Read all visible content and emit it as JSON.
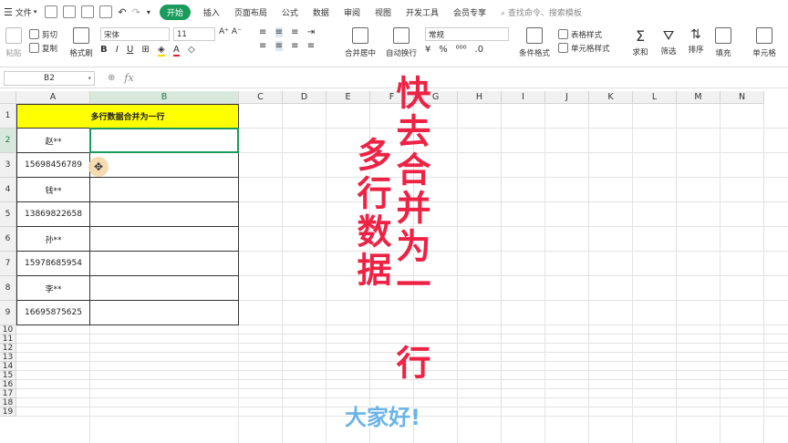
{
  "toolbar": {
    "menu_label": "文件",
    "tabs": [
      "开始",
      "插入",
      "页面布局",
      "公式",
      "数据",
      "审阅",
      "视图",
      "开发工具",
      "会员专享"
    ],
    "search_placeholder": "查找命令、搜索模板"
  },
  "ribbon": {
    "paste": "粘贴",
    "cut": "剪切",
    "copy": "复制",
    "format_painter": "格式刷",
    "font_name": "宋体",
    "font_size": "11",
    "bold": "B",
    "italic": "I",
    "underline": "U",
    "merge_center": "合并居中",
    "wrap_text": "自动换行",
    "number_format": "常规",
    "percent": "%",
    "table_style": "表格样式",
    "cond_format": "条件格式",
    "cell_style": "单元格样式",
    "sum": "求和",
    "filter": "筛选",
    "sort": "排序",
    "fill": "填充",
    "cells": "单元格"
  },
  "formula_bar": {
    "name_box": "B2",
    "fx": "fx",
    "value": ""
  },
  "columns": [
    "A",
    "B",
    "C",
    "D",
    "E",
    "F",
    "G",
    "H",
    "I",
    "J",
    "K",
    "L",
    "M",
    "N"
  ],
  "rows": [
    "1",
    "2",
    "3",
    "4",
    "5",
    "6",
    "7",
    "8",
    "9",
    "10",
    "11",
    "12",
    "13",
    "14",
    "15",
    "16",
    "17",
    "18",
    "19"
  ],
  "table": {
    "title": "多行数据合并为一行",
    "a_values": [
      "赵**",
      "15698456789",
      "钱**",
      "13869822658",
      "孙**",
      "15978685954",
      "李**",
      "16695875625"
    ]
  },
  "overlay": {
    "left_text": "多行数据",
    "right_text": "快去合并为一行",
    "greeting": "大家好!"
  },
  "colors": {
    "accent": "#1a9b5c",
    "highlight": "#ffff00",
    "overlay": "#ee2244",
    "greeting": "#6ab4e8"
  }
}
